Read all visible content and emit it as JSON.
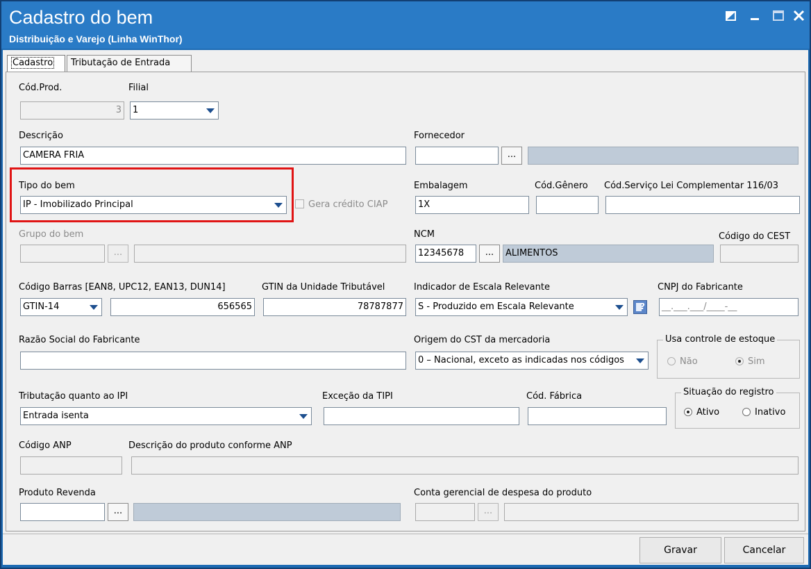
{
  "window": {
    "title": "Cadastro do bem",
    "subtitle": "Distribuição e Varejo (Linha WinThor)"
  },
  "tabs": [
    {
      "label": "Cadastro",
      "active": true
    },
    {
      "label": "Tributação de Entrada",
      "active": false
    }
  ],
  "fields": {
    "cod_prod": {
      "label": "Cód.Prod.",
      "value": "3"
    },
    "filial": {
      "label": "Filial",
      "value": "1"
    },
    "descricao": {
      "label": "Descrição",
      "value": "CAMERA FRIA"
    },
    "fornecedor": {
      "label": "Fornecedor",
      "value": "",
      "button": "..."
    },
    "tipo_bem": {
      "label": "Tipo do bem",
      "value": "IP - Imobilizado Principal"
    },
    "gera_credito": {
      "label": "Gera crédito CIAP",
      "checked": false
    },
    "embalagem": {
      "label": "Embalagem",
      "value": "1X"
    },
    "cod_genero": {
      "label": "Cód.Gênero",
      "value": ""
    },
    "cod_servico": {
      "label": "Cód.Serviço Lei Complementar 116/03",
      "value": ""
    },
    "grupo_bem": {
      "label": "Grupo do bem",
      "value": "",
      "button": "..."
    },
    "ncm": {
      "label": "NCM",
      "value": "12345678",
      "button": "...",
      "description": "ALIMENTOS"
    },
    "cest": {
      "label": "Código do CEST",
      "value": ""
    },
    "codigo_barras": {
      "label": "Código Barras [EAN8, UPC12, EAN13, DUN14]",
      "type": "GTIN-14",
      "value": "656565"
    },
    "gtin_trib": {
      "label": "GTIN da Unidade Tributável",
      "value": "78787877"
    },
    "escala": {
      "label": "Indicador de Escala Relevante",
      "value": "S - Produzido em Escala Relevante"
    },
    "cnpj_fab": {
      "label": "CNPJ do Fabricante",
      "value": "__.___.___/____-__"
    },
    "razao_social": {
      "label": "Razão Social do Fabricante",
      "value": ""
    },
    "origem_cst": {
      "label": "Origem do CST da mercadoria",
      "value": "0 – Nacional, exceto as indicadas nos códigos"
    },
    "controle_estoque": {
      "label": "Usa controle de estoque",
      "options": [
        "Não",
        "Sim"
      ],
      "selected": "Sim"
    },
    "trib_ipi": {
      "label": "Tributação quanto ao IPI",
      "value": "Entrada isenta"
    },
    "excecao_tipi": {
      "label": "Exceção da TIPI",
      "value": ""
    },
    "cod_fabrica": {
      "label": "Cód. Fábrica",
      "value": ""
    },
    "situacao": {
      "label": "Situação do registro",
      "options": [
        "Ativo",
        "Inativo"
      ],
      "selected": "Ativo"
    },
    "codigo_anp": {
      "label": "Código ANP",
      "value": ""
    },
    "descricao_anp": {
      "label": "Descrição do produto conforme ANP",
      "value": ""
    },
    "produto_revenda": {
      "label": "Produto Revenda",
      "value": "",
      "button": "..."
    },
    "conta_gerencial": {
      "label": "Conta gerencial de despesa do produto",
      "value": "",
      "button": "..."
    }
  },
  "buttons": {
    "gravar": {
      "accel": "G",
      "rest": "ravar"
    },
    "cancelar": {
      "accel": "C",
      "rest": "ancelar"
    }
  },
  "colors": {
    "titlebar": "#2a7bc6",
    "highlight": "#e01414",
    "readonly": "#bfcbd8"
  }
}
